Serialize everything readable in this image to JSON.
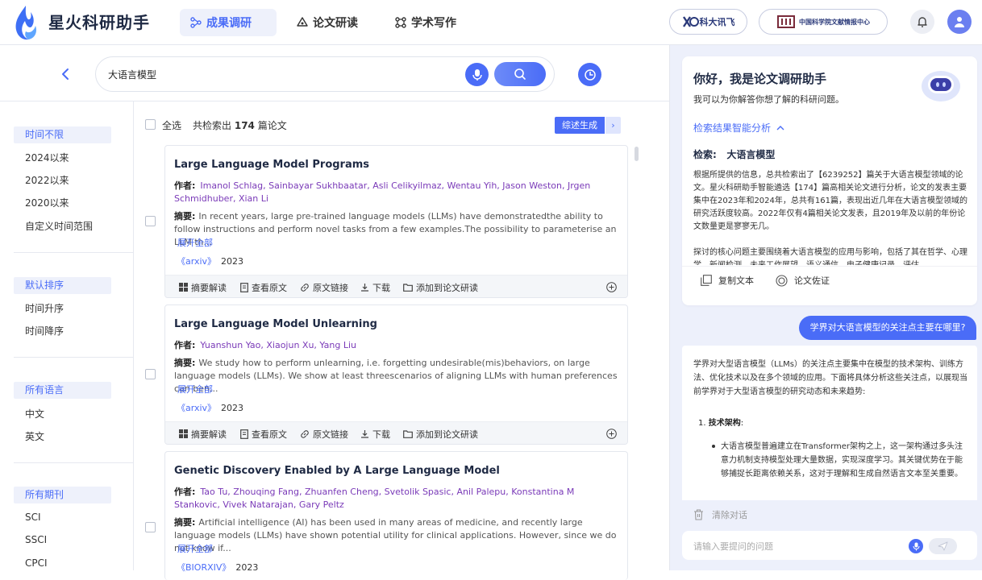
{
  "header": {
    "app_title": "星火科研助手",
    "tabs": [
      {
        "label": "成果调研",
        "active": true
      },
      {
        "label": "论文研读",
        "active": false
      },
      {
        "label": "学术写作",
        "active": false
      }
    ],
    "partners": {
      "iflytek": "科大讯飞",
      "cas_center": "中国科学院文献情报中心"
    },
    "accent_color": "#4a6cf7"
  },
  "search": {
    "query": "大语言模型"
  },
  "filters": {
    "time": {
      "head": "时间不限",
      "items": [
        "2024以来",
        "2022以来",
        "2020以来",
        "自定义时间范围"
      ]
    },
    "sort": {
      "head": "默认排序",
      "items": [
        "时间升序",
        "时间降序"
      ]
    },
    "language": {
      "head": "所有语言",
      "items": [
        "中文",
        "英文"
      ]
    },
    "journal": {
      "head": "所有期刊",
      "items": [
        "SCI",
        "SSCI",
        "CPCI"
      ]
    }
  },
  "results": {
    "select_all": "全选",
    "count_prefix": "共检索出",
    "count": "174",
    "count_suffix": "篇论文",
    "summary_button": "综述生成",
    "labels": {
      "authors": "作者:",
      "abstract": "摘要:",
      "expand": "展开全部"
    },
    "actions": [
      "摘要解读",
      "查看原文",
      "原文链接",
      "下载",
      "添加到论文研读"
    ],
    "papers": [
      {
        "title": "Large Language Model Programs",
        "authors": "Imanol Schlag, Sainbayar Sukhbaatar, Asli Celikyilmaz, Wentau Yih, Jason Weston, Jrgen Schmidhuber, Xian Li",
        "abstract": "In recent years, large pre-trained language models (LLMs) have demonstratedthe ability to follow instructions and perform novel tasks from a few examples.The possibility to parameterise an LLM th...",
        "source": "《arxiv》",
        "year": "2023"
      },
      {
        "title": "Large Language Model Unlearning",
        "authors": "Yuanshun Yao, Xiaojun Xu, Yang Liu",
        "abstract": "We study how to perform unlearning, i.e. forgetting undesirable(mis)behaviors, on large language models (LLMs). We show at least threescenarios of aligning LLMs with human preferences can ben...",
        "source": "《arxiv》",
        "year": "2023"
      },
      {
        "title": "Genetic Discovery Enabled by A Large Language Model",
        "authors": "Tao Tu, Zhouqing Fang, Zhuanfen Cheng, Svetolik Spasic, Anil Palepu, Konstantina M Stankovic, Vivek Natarajan, Gary Peltz",
        "abstract": "Artificial intelligence (AI) has been used in many areas of medicine, and recently large language models (LLMs) have shown potential utility for clinical applications. However, since we do not know if...",
        "source": "《BIORXIV》",
        "year": "2023"
      }
    ]
  },
  "assistant": {
    "title": "你好，我是论文调研助手",
    "subtitle": "我可以为你解答你想了解的科研问题。",
    "analysis_toggle": "检索结果智能分析",
    "query_label": "检索:",
    "query_value": "大语言模型",
    "analysis_p1": "根据所提供的信息，总共检索出了【6239252】篇关于大语言模型领域的论文。星火科研助手智能遴选【174】篇高相关论文进行分析，论文的发表主要集中在2023年和2024年，总共有161篇，表现出近几年在大语言模型领域的研究活跃度较高。2022年仅有4篇相关论文发表，且2019年及以前的年份论文数量更是寥寥无几。",
    "analysis_p2": "探讨的核心问题主要围绕着大语言模型的应用与影响，包括了其在哲学、心理学、新闻检测、未来工作展望、语义通信、电子健康记录、评估",
    "copy_label": "复制文本",
    "verify_label": "论文佐证",
    "user_question": "学界对大语言模型的关注点主要在哪里?",
    "answer_intro": "学界对大型语言模型（LLMs）的关注点主要集中在模型的技术架构、训练方法、优化技术以及在多个领域的应用。下面将具体分析这些关注点，以展现当前学界对于大型语言模型的研究动态和未来趋势:",
    "answer_h1_num": "1.",
    "answer_h1": "技术架构",
    "answer_h1_colon": ":",
    "answer_bullet": "大语言模型普遍建立在Transformer架构之上，这一架构通过多头注意力机制支持模型处理大量数据，实现深度学习。其关键优势在于能够捕捉长距离依赖关系，这对于理解和生成自然语言文本至关重要。",
    "clear_label": "清除对话",
    "input_placeholder": "请输入要提问的问题"
  }
}
